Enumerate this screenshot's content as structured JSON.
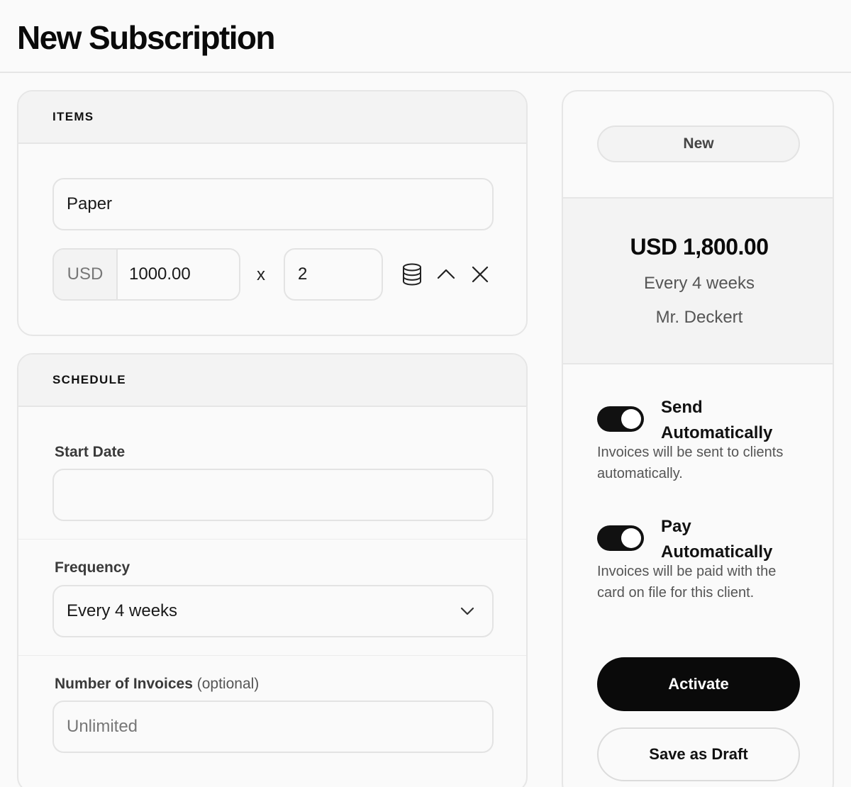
{
  "page": {
    "title": "New Subscription"
  },
  "items_card": {
    "heading": "ITEMS",
    "item": {
      "name": "Paper",
      "currency": "USD",
      "price": "1000.00",
      "multiply_sign": "x",
      "quantity": "2",
      "icons": [
        "database-icon",
        "chevron-up-icon",
        "close-icon"
      ]
    }
  },
  "schedule_card": {
    "heading": "SCHEDULE",
    "start_date": {
      "label": "Start Date",
      "value": ""
    },
    "frequency": {
      "label": "Frequency",
      "selected": "Every 4 weeks"
    },
    "invoices": {
      "label": "Number of Invoices",
      "optional_label": "(optional)",
      "placeholder": "Unlimited"
    }
  },
  "summary": {
    "status": "New",
    "total": "USD 1,800.00",
    "frequency": "Every 4 weeks",
    "client": "Mr. Deckert"
  },
  "settings": {
    "send": {
      "title_line1": "Send",
      "title_line2": "Automatically",
      "description": "Invoices will be sent to clients automatically.",
      "on": true
    },
    "pay": {
      "title_line1": "Pay",
      "title_line2": "Automatically",
      "description": "Invoices will be paid with the card on file for this client.",
      "on": true
    }
  },
  "actions": {
    "activate": "Activate",
    "save_draft": "Save as Draft"
  },
  "colors": {
    "accent": "#0a0a0a",
    "border": "#e6e6e6",
    "panel": "#f3f3f3",
    "background": "#fafafa"
  }
}
